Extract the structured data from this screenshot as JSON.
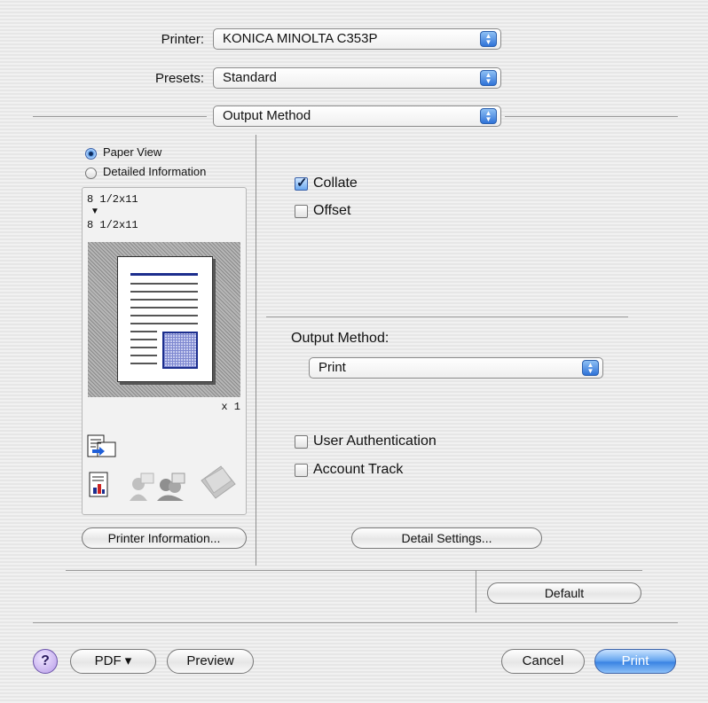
{
  "header": {
    "printer_label": "Printer:",
    "printer_value": "KONICA MINOLTA C353P",
    "presets_label": "Presets:",
    "presets_value": "Standard",
    "pane_value": "Output Method"
  },
  "left_panel": {
    "radio_paper_view": "Paper View",
    "radio_detailed": "Detailed Information",
    "selected_view": "Paper View",
    "paper_size_top": "8 1/2x11",
    "arrow_glyph": "▼",
    "paper_size_bottom": "8 1/2x11",
    "copies": "x 1",
    "printer_info_button": "Printer Information..."
  },
  "right_panel": {
    "collate_label": "Collate",
    "collate_checked": true,
    "offset_label": "Offset",
    "offset_checked": false,
    "output_method_label": "Output Method:",
    "output_method_value": "Print",
    "user_auth_label": "User Authentication",
    "account_track_label": "Account Track",
    "detail_settings_button": "Detail Settings..."
  },
  "default_button": "Default",
  "footer": {
    "help_glyph": "?",
    "pdf_button": "PDF ▾",
    "preview_button": "Preview",
    "cancel_button": "Cancel",
    "print_button": "Print"
  },
  "colors": {
    "accent_blue": "#3b84e3",
    "paper_lines": "#1c2e8e"
  }
}
